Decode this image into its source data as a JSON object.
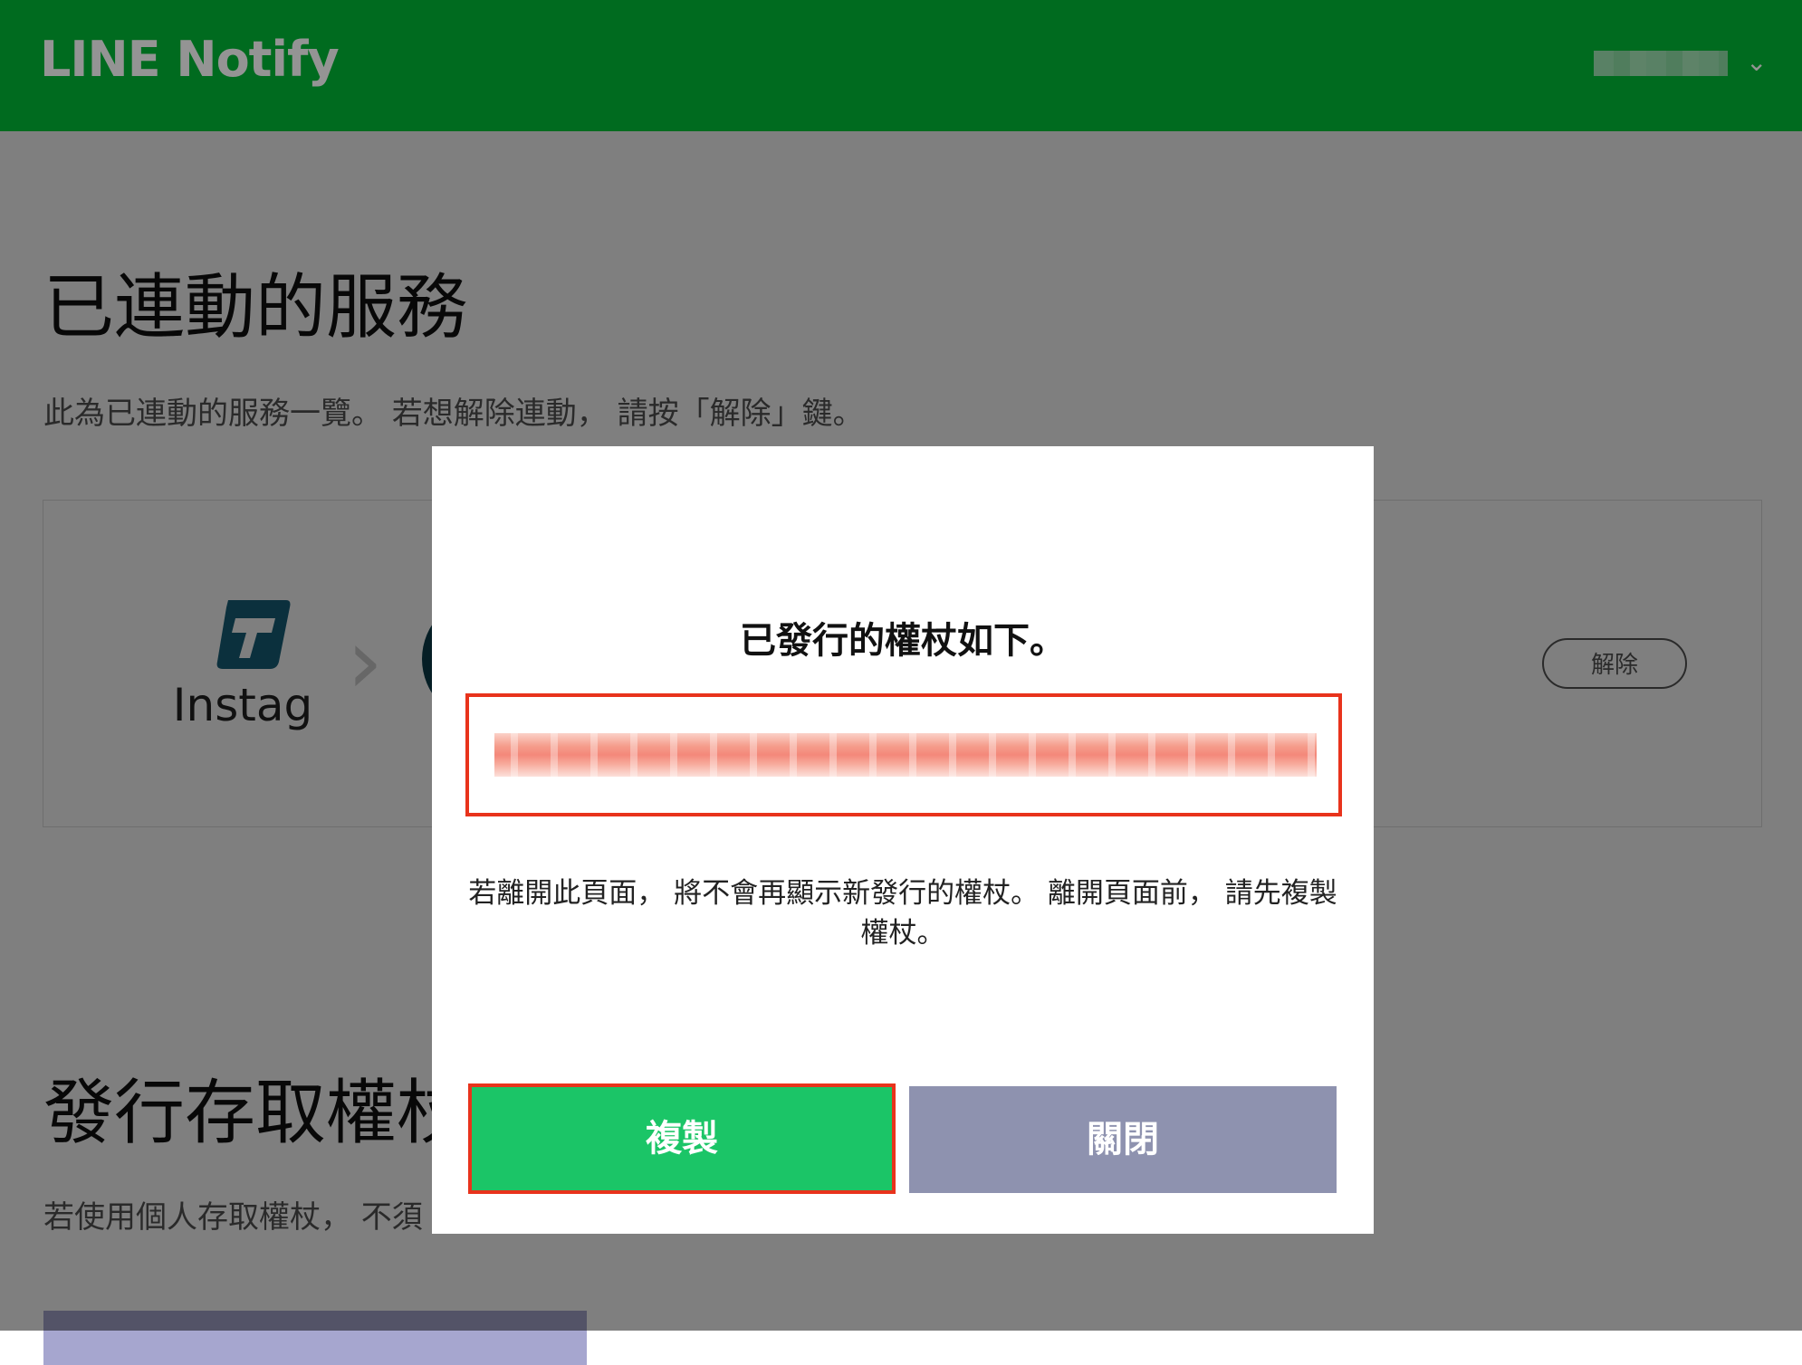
{
  "header": {
    "logo": "LINE Notify",
    "user_name": "████ ███"
  },
  "page": {
    "title": "已連動的服務",
    "description": "此為已連動的服務一覽。 若想解除連動， 請按「解除」鍵。",
    "service": {
      "name": "Instag",
      "unlink_label": "解除"
    },
    "section2": {
      "title": "發行存取權杖",
      "description": "若使用個人存取權杖， 不須"
    }
  },
  "modal": {
    "title": "已發行的權杖如下。",
    "token": "████████████████████████████████████████████",
    "warning": "若離開此頁面， 將不會再顯示新發行的權杖。 離開頁面前， 請先複製權杖。",
    "copy_label": "複製",
    "close_label": "關閉"
  },
  "colors": {
    "line_green": "#00B836",
    "copy_green": "#1BC567",
    "close_gray": "#8E92AF",
    "highlight_red": "#E8331C"
  },
  "icons": {
    "chevron": "chevron-down-icon",
    "arrow": "arrow-right-icon"
  }
}
